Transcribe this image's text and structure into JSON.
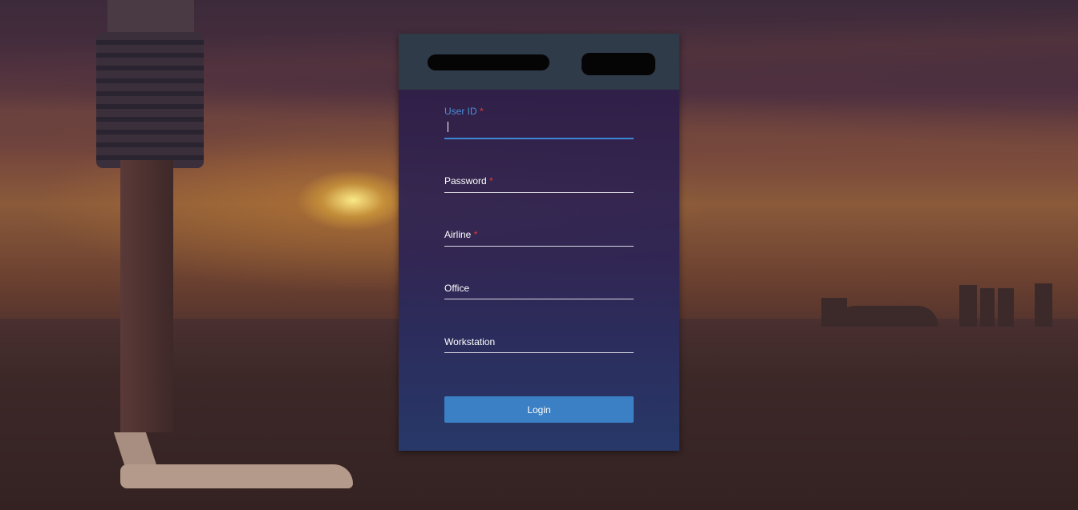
{
  "login_form": {
    "fields": [
      {
        "label": "User ID",
        "required_mark": "*",
        "value": ""
      },
      {
        "label": "Password",
        "required_mark": "*",
        "value": ""
      },
      {
        "label": "Airline",
        "required_mark": "*",
        "value": ""
      },
      {
        "label": "Office",
        "required_mark": "",
        "value": ""
      },
      {
        "label": "Workstation",
        "required_mark": "",
        "value": ""
      }
    ],
    "login_label": "Login"
  },
  "colors": {
    "accent": "#3b7fc4",
    "active_label": "#4a8fd8",
    "required": "#e53935",
    "header_bg": "#2f3b48"
  }
}
